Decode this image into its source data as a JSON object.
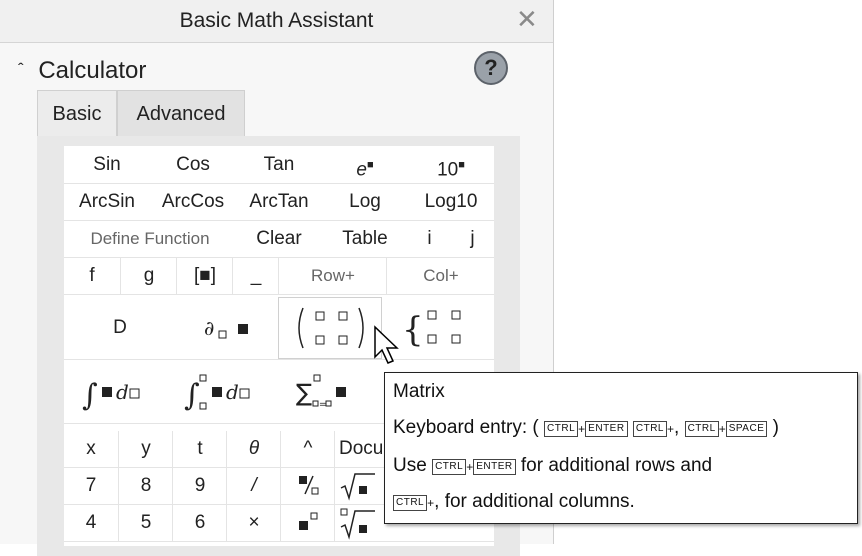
{
  "window": {
    "title": "Basic Math Assistant",
    "close": "✕"
  },
  "section": {
    "toggle": "ˆ",
    "title": "Calculator",
    "help": "?"
  },
  "tabs": [
    "Basic",
    "Advanced"
  ],
  "rows": {
    "r1": [
      "Sin",
      "Cos",
      "Tan",
      "e",
      "10"
    ],
    "r2": [
      "ArcSin",
      "ArcCos",
      "ArcTan",
      "Log",
      "Log10"
    ],
    "r3": [
      "Define Function",
      "Clear",
      "Table",
      "i",
      "j"
    ],
    "r4": [
      "f",
      "g",
      "[■]",
      "_",
      "Row+",
      "Col+"
    ],
    "r5": {
      "derivative": "D"
    },
    "r8": [
      "x",
      "y",
      "t",
      "θ",
      "^",
      "Docu"
    ],
    "r9": [
      "7",
      "8",
      "9",
      "/"
    ],
    "r10": [
      "4",
      "5",
      "6",
      "×"
    ]
  },
  "tooltip": {
    "title": "Matrix",
    "line2_prefix": "Keyboard entry: (",
    "line2_suffix": ")",
    "line3_prefix": "Use",
    "line3_suffix": "for additional rows and",
    "line4_suffix": "for additional columns.",
    "keys": {
      "ctrl": "CTRL",
      "enter": "ENTER",
      "space": "SPACE",
      "comma": ",",
      "plus": "+"
    }
  }
}
